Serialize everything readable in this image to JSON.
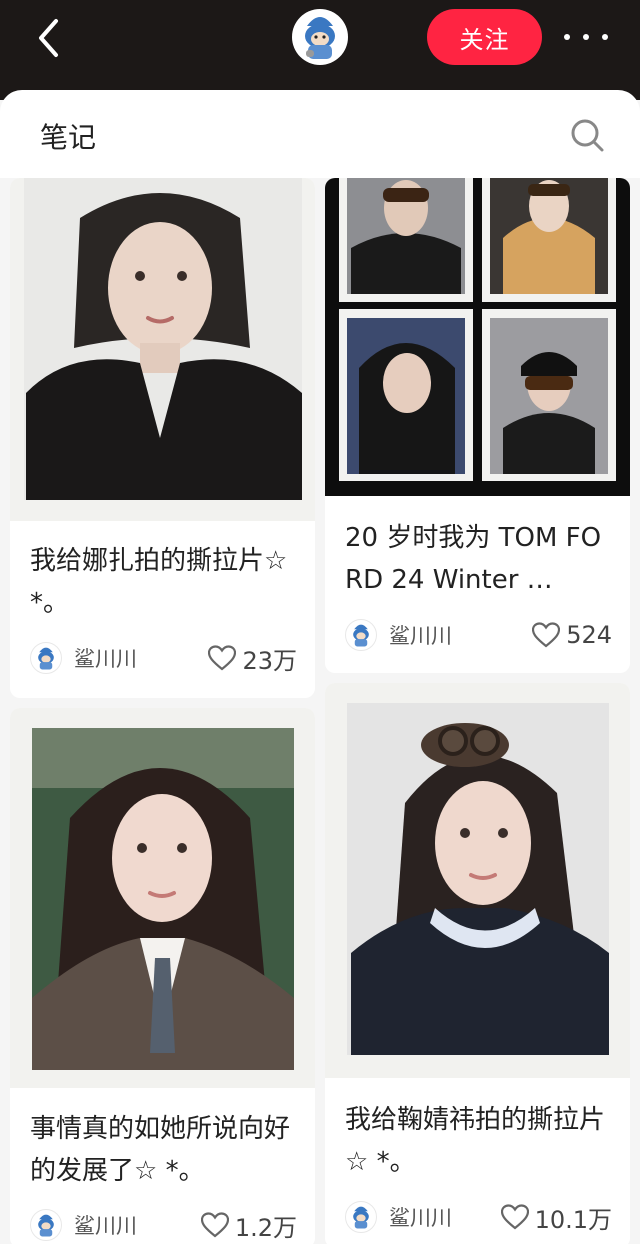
{
  "header": {
    "follow_label": "关注"
  },
  "section": {
    "title": "笔记"
  },
  "notes": [
    {
      "title": "我给娜扎拍的撕拉片☆ *。",
      "author": "鲨川川",
      "likes": "23万"
    },
    {
      "title": "20 岁时我为 TOM FORD 24 Winter …",
      "author": "鲨川川",
      "likes": "524"
    },
    {
      "title": "事情真的如她所说向好的发展了☆ *。",
      "author": "鲨川川",
      "likes": "1.2万"
    },
    {
      "title": "我给鞠婧祎拍的撕拉片☆ *。",
      "author": "鲨川川",
      "likes": "10.1万"
    }
  ],
  "colors": {
    "accent": "#ff2442",
    "topbar": "#1c1817",
    "avatar_blue": "#3a78c2"
  },
  "icons": [
    "back-icon",
    "more-icon",
    "search-icon",
    "heart-icon",
    "shark-avatar"
  ]
}
